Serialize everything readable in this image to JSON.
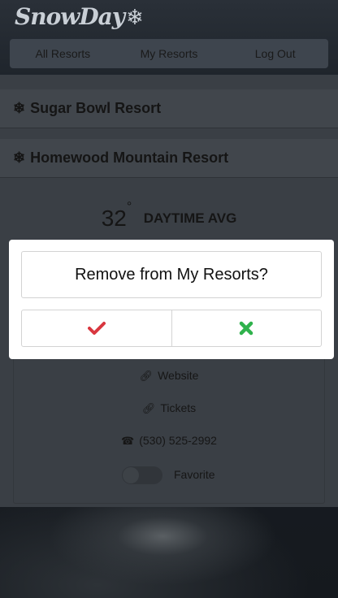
{
  "app": {
    "logo_text": "SnowDay",
    "logo_glyph": "❄"
  },
  "nav": {
    "items": [
      {
        "label": "All Resorts"
      },
      {
        "label": "My Resorts"
      },
      {
        "label": "Log Out"
      }
    ]
  },
  "resorts": [
    {
      "name": "Sugar Bowl Resort",
      "icon": "snowflake-icon"
    },
    {
      "name": "Homewood Mountain Resort",
      "icon": "snowflake-icon"
    }
  ],
  "weather": {
    "temperature": "32",
    "degree": "°",
    "label": "DAYTIME AVG"
  },
  "details": {
    "website_label": "Website",
    "tickets_label": "Tickets",
    "phone": "(530) 525-2992",
    "favorite_label": "Favorite",
    "favorite_on": false
  },
  "modal": {
    "title": "Remove from My Resorts?",
    "confirm_icon": "check-icon",
    "cancel_icon": "close-icon",
    "confirm_color": "#d9373f",
    "cancel_color": "#2fb24c"
  }
}
